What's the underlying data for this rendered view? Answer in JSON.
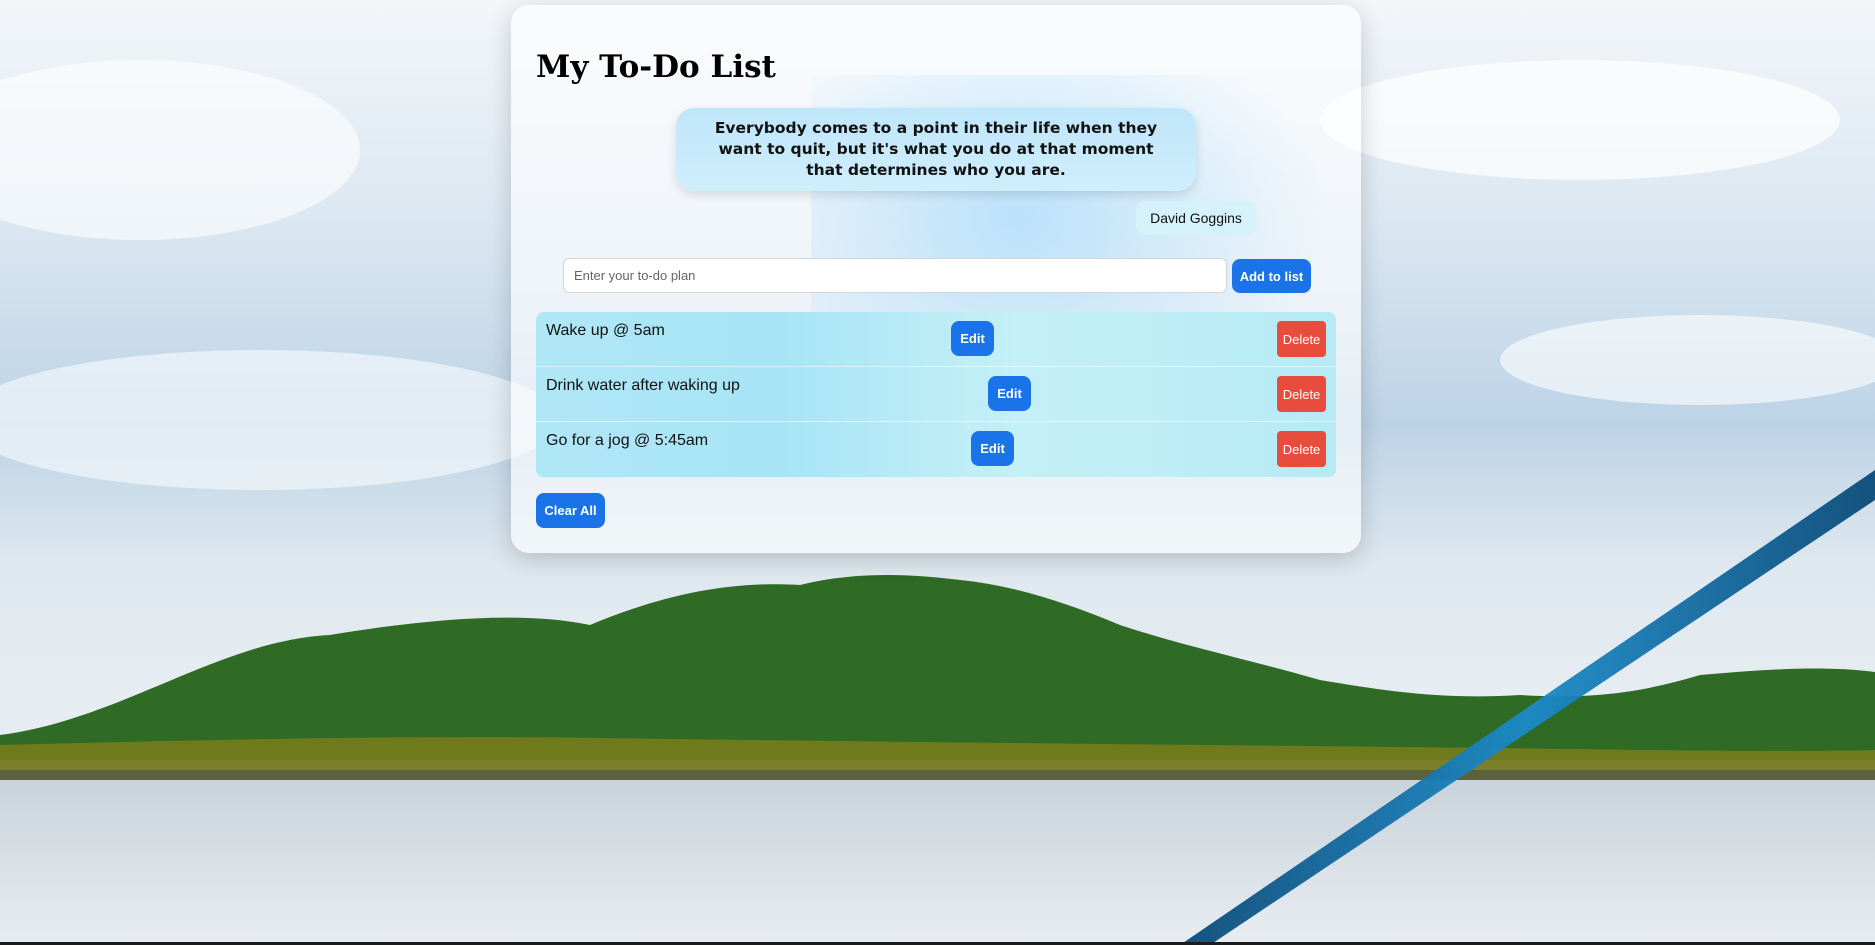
{
  "app": {
    "title": "My To-Do List"
  },
  "quote": {
    "text": "Everybody comes to a point in their life when they want to quit, but it's what you do at that moment that determines who you are.",
    "author": "David Goggins"
  },
  "form": {
    "placeholder": "Enter your to-do plan",
    "value": "",
    "add_label": "Add to list"
  },
  "todos": [
    {
      "text": "Wake up @ 5am",
      "edit_label": "Edit",
      "delete_label": "Delete"
    },
    {
      "text": "Drink water after waking up",
      "edit_label": "Edit",
      "delete_label": "Delete"
    },
    {
      "text": "Go for a jog @ 5:45am",
      "edit_label": "Edit",
      "delete_label": "Delete"
    }
  ],
  "clear_label": "Clear All",
  "colors": {
    "primary": "#1a73e8",
    "danger": "#e74c3c",
    "item_bg": "#b0e7f6",
    "quote_bg": "#bfe6fa"
  }
}
